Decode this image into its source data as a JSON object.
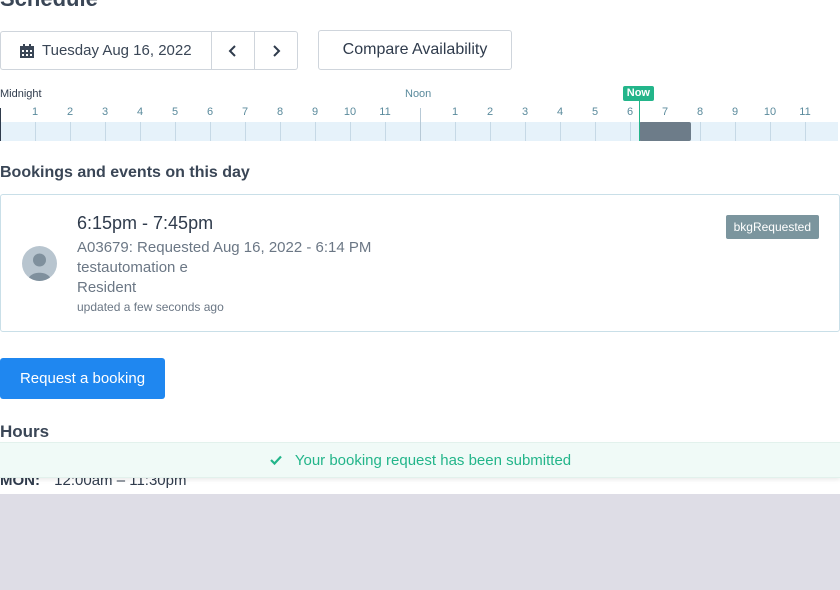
{
  "page": {
    "title": "Schedule"
  },
  "date_picker": {
    "date_label": "Tuesday Aug 16, 2022",
    "prev_icon": "chevron-left-icon",
    "next_icon": "chevron-right-icon",
    "calendar_icon": "calendar-icon"
  },
  "compare_button": {
    "label": "Compare Availability"
  },
  "timeline": {
    "start_label": "Midnight",
    "noon_label": "Noon",
    "hour_labels_am": [
      "1",
      "2",
      "3",
      "4",
      "5",
      "6",
      "7",
      "8",
      "9",
      "10",
      "11"
    ],
    "hour_labels_pm": [
      "1",
      "2",
      "3",
      "4",
      "5",
      "6",
      "7",
      "8",
      "9",
      "10",
      "11"
    ],
    "now_label": "Now",
    "now_time_hours": 18.25,
    "booking_start_hours": 18.25,
    "booking_end_hours": 19.75
  },
  "bookings_section": {
    "title": "Bookings and events on this day",
    "booking": {
      "time_range": "6:15pm - 7:45pm",
      "reference": "A03679: Requested Aug 16, 2022 - 6:14 PM",
      "user_name": "testautomation e",
      "user_role": "Resident",
      "updated": "updated a few seconds ago",
      "status": "bkgRequested",
      "status_color": "#7b959e"
    }
  },
  "request_button": {
    "label": "Request a booking",
    "color": "#1f87f0"
  },
  "hours": {
    "title": "Hours",
    "rows": [
      {
        "day": "MON:",
        "range": "12:00am – 11:30pm"
      }
    ]
  },
  "toast": {
    "message": "Your booking request has been submitted",
    "color": "#23b58a"
  }
}
